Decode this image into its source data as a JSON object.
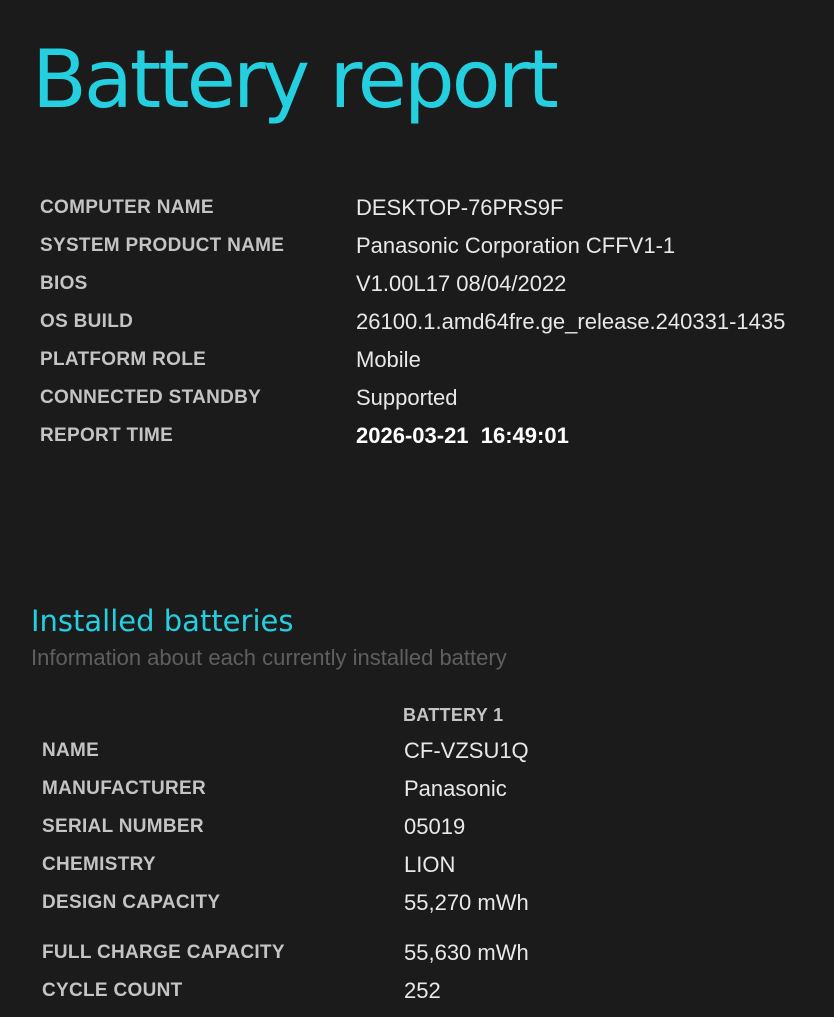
{
  "page": {
    "title": "Battery report"
  },
  "system_info": [
    {
      "label": "COMPUTER NAME",
      "value": "DESKTOP-76PRS9F"
    },
    {
      "label": "SYSTEM PRODUCT NAME",
      "value": "Panasonic Corporation CFFV1-1"
    },
    {
      "label": "BIOS",
      "value": "V1.00L17 08/04/2022"
    },
    {
      "label": "OS BUILD",
      "value": "26100.1.amd64fre.ge_release.240331-1435"
    },
    {
      "label": "PLATFORM ROLE",
      "value": "Mobile"
    },
    {
      "label": "CONNECTED STANDBY",
      "value": "Supported"
    },
    {
      "label": "REPORT TIME",
      "value": "2026-03-21  16:49:01"
    }
  ],
  "installed_batteries": {
    "title": "Installed batteries",
    "subtitle": "Information about each currently installed battery",
    "column_header": "BATTERY 1",
    "rows": [
      {
        "label": "NAME",
        "value": "CF-VZSU1Q"
      },
      {
        "label": "MANUFACTURER",
        "value": "Panasonic"
      },
      {
        "label": "SERIAL NUMBER",
        "value": "05019"
      },
      {
        "label": "CHEMISTRY",
        "value": "LION"
      },
      {
        "label": "DESIGN CAPACITY",
        "value": "55,270 mWh"
      },
      {
        "label": "FULL CHARGE CAPACITY",
        "value": "55,630 mWh"
      },
      {
        "label": "CYCLE COUNT",
        "value": "252"
      }
    ]
  },
  "colors": {
    "background": "#1b1b1b",
    "accent": "#24cfe0",
    "label": "#c4c4c4",
    "value": "#e8e8e8",
    "subtitle": "#5f5f5f"
  }
}
